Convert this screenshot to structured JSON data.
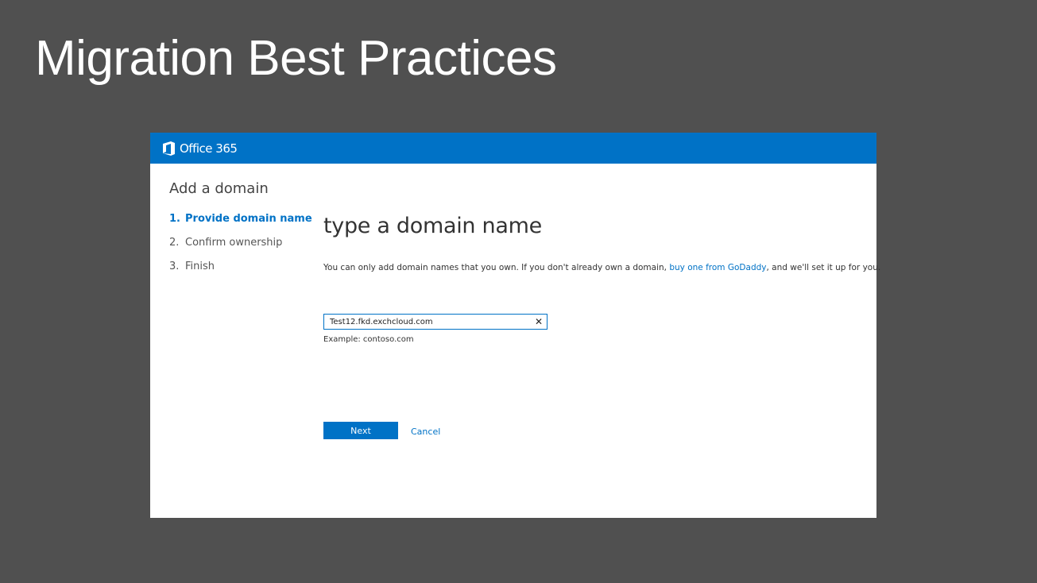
{
  "slide": {
    "title": "Migration Best Practices"
  },
  "app": {
    "brand": "Office 365",
    "brand_icon": "office-logo-icon",
    "accent_color": "#0072c6"
  },
  "page": {
    "heading": "Add a domain"
  },
  "steps": [
    {
      "number": "1.",
      "label": "Provide domain name",
      "active": true
    },
    {
      "number": "2.",
      "label": "Confirm ownership",
      "active": false
    },
    {
      "number": "3.",
      "label": "Finish",
      "active": false
    }
  ],
  "main": {
    "heading": "type a domain name",
    "description_before": "You can only add domain names that you own. If you don't already own a domain, ",
    "description_link": "buy one from GoDaddy",
    "description_after": ", and we'll set it up for you.",
    "domain_input_value": "Test12.fkd.exchcloud.com",
    "clear_icon": "close-icon",
    "example": "Example: contoso.com",
    "next_label": "Next",
    "cancel_label": "Cancel"
  }
}
